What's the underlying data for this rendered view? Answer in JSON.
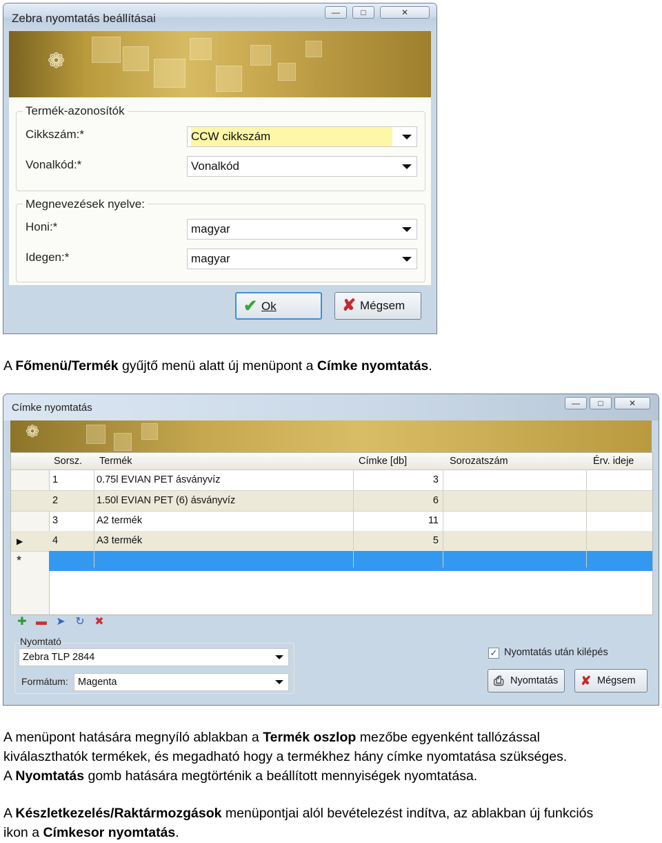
{
  "window1": {
    "title": "Zebra nyomtatás beállításai",
    "group_ids": {
      "label": "Termék-azonosítók",
      "fields": [
        {
          "label": "Cikkszám:*",
          "value": "CCW cikkszám"
        },
        {
          "label": "Vonalkód:*",
          "value": "Vonalkód"
        }
      ]
    },
    "group_lang": {
      "label": "Megnevezések nyelve:",
      "fields": [
        {
          "label": "Honi:*",
          "value": "magyar"
        },
        {
          "label": "Idegen:*",
          "value": "magyar"
        }
      ]
    },
    "ok_label": "Ok",
    "cancel_label": "Mégsem"
  },
  "para1": {
    "t1": "A ",
    "b1": "Főmenü/Termék",
    "t2": " gyűjtő menü alatt új menüpont a ",
    "b2": "Címke nyomtatás",
    "t3": "."
  },
  "window2": {
    "title": "Címke nyomtatás",
    "columns": [
      "Sorsz.",
      "Termék",
      "Címke [db]",
      "Sorozatszám",
      "Érv. ideje"
    ],
    "rows": [
      {
        "no": "1",
        "product": "0.75l EVIAN PET ásványvíz",
        "count": "3",
        "serial": "",
        "expiry": ""
      },
      {
        "no": "2",
        "product": "1.50l EVIAN PET (6) ásványvíz",
        "count": "6",
        "serial": "",
        "expiry": ""
      },
      {
        "no": "3",
        "product": "A2 termék",
        "count": "11",
        "serial": "",
        "expiry": ""
      },
      {
        "no": "4",
        "product": "A3 termék",
        "count": "5",
        "serial": "",
        "expiry": ""
      }
    ],
    "new_row_marker": "*",
    "printer_group_label": "Nyomtató",
    "printer_value": "Zebra TLP 2844",
    "format_label": "Formátum:",
    "format_value": "Magenta",
    "exit_after_print_label": "Nyomtatás után kilépés",
    "exit_after_print_checked": true,
    "print_button_label": "Nyomtatás",
    "cancel_button_label": "Mégsem"
  },
  "para2": {
    "l1a": "A menüpont hatására megnyíló ablakban a ",
    "l1b": "Termék oszlop",
    "l1c": " mezőbe egyenként tallózással",
    "l2": "kiválaszthatók termékek, és megadható hogy a termékhez hány címke nyomtatása szükséges.",
    "l3a": "A ",
    "l3b": "Nyomtatás",
    "l3c": " gomb hatására megtörténik a beállított mennyiségek nyomtatása."
  },
  "para3": {
    "l1a": "A ",
    "l1b": "Készletkezelés/Raktármozgások",
    "l1c": " menüpontjai alól bevételezést indítva, az ablakban új funkciós",
    "l2a": "ikon a ",
    "l2b": "Címkesor nyomtatás",
    "l2c": "."
  }
}
